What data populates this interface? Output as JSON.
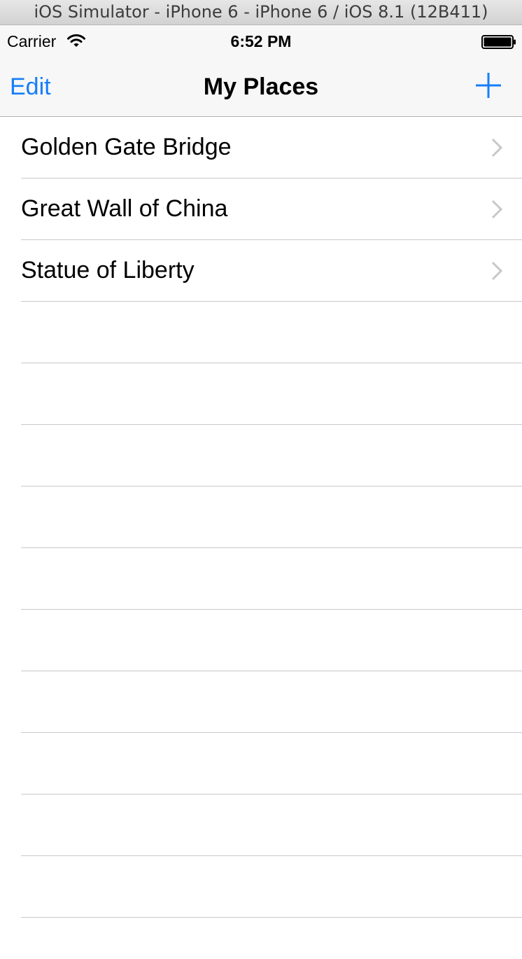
{
  "window": {
    "title": "iOS Simulator - iPhone 6 - iPhone 6 / iOS 8.1 (12B411)"
  },
  "status_bar": {
    "carrier": "Carrier",
    "time": "6:52 PM",
    "wifi_icon": "wifi-icon",
    "battery_icon": "battery-full-icon"
  },
  "nav_bar": {
    "left_button": "Edit",
    "title": "My Places",
    "right_button_icon": "plus-icon"
  },
  "places": [
    {
      "name": "Golden Gate Bridge"
    },
    {
      "name": "Great Wall of China"
    },
    {
      "name": "Statue of Liberty"
    }
  ],
  "colors": {
    "tint": "#157efb",
    "nav_background": "#f7f7f7",
    "separator": "#c8c7cc",
    "chevron": "#c7c7cc"
  }
}
